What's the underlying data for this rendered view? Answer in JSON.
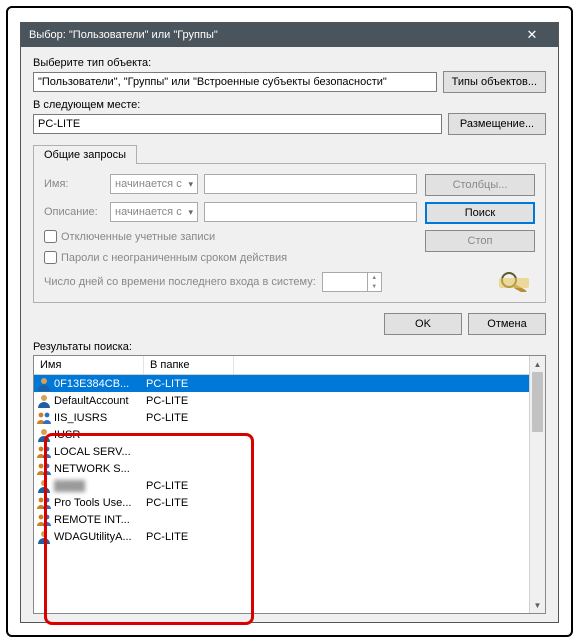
{
  "window": {
    "title": "Выбор: \"Пользователи\" или \"Группы\"",
    "close_glyph": "✕"
  },
  "object_type": {
    "label": "Выберите тип объекта:",
    "value": "\"Пользователи\", \"Группы\" или \"Встроенные субъекты безопасности\"",
    "button": "Типы объектов..."
  },
  "location": {
    "label": "В следующем месте:",
    "value": "PC-LITE",
    "button": "Размещение..."
  },
  "tab": {
    "label": "Общие запросы"
  },
  "queries": {
    "name_label": "Имя:",
    "desc_label": "Описание:",
    "starts_with": "начинается с",
    "chk_disabled": "Отключенные учетные записи",
    "chk_password": "Пароли с неограниченным сроком действия",
    "days_label": "Число дней со времени последнего входа в систему:"
  },
  "buttons": {
    "columns": "Столбцы...",
    "search": "Поиск",
    "stop": "Стоп",
    "ok": "OK",
    "cancel": "Отмена"
  },
  "results": {
    "label": "Результаты поиска:",
    "col_name": "Имя",
    "col_folder": "В папке",
    "rows": [
      {
        "name": "0F13E384CB...",
        "folder": "PC-LITE",
        "type": "user",
        "selected": true
      },
      {
        "name": "DefaultAccount",
        "folder": "PC-LITE",
        "type": "user"
      },
      {
        "name": "IIS_IUSRS",
        "folder": "PC-LITE",
        "type": "group"
      },
      {
        "name": "IUSR",
        "folder": "",
        "type": "user"
      },
      {
        "name": "LOCAL SERV...",
        "folder": "",
        "type": "group"
      },
      {
        "name": "NETWORK S...",
        "folder": "",
        "type": "group"
      },
      {
        "name": "",
        "folder": "PC-LITE",
        "type": "user",
        "blurred": true
      },
      {
        "name": "Pro Tools Use...",
        "folder": "PC-LITE",
        "type": "group"
      },
      {
        "name": "REMOTE INT...",
        "folder": "",
        "type": "group"
      },
      {
        "name": "WDAGUtilityA...",
        "folder": "PC-LITE",
        "type": "user"
      }
    ]
  }
}
